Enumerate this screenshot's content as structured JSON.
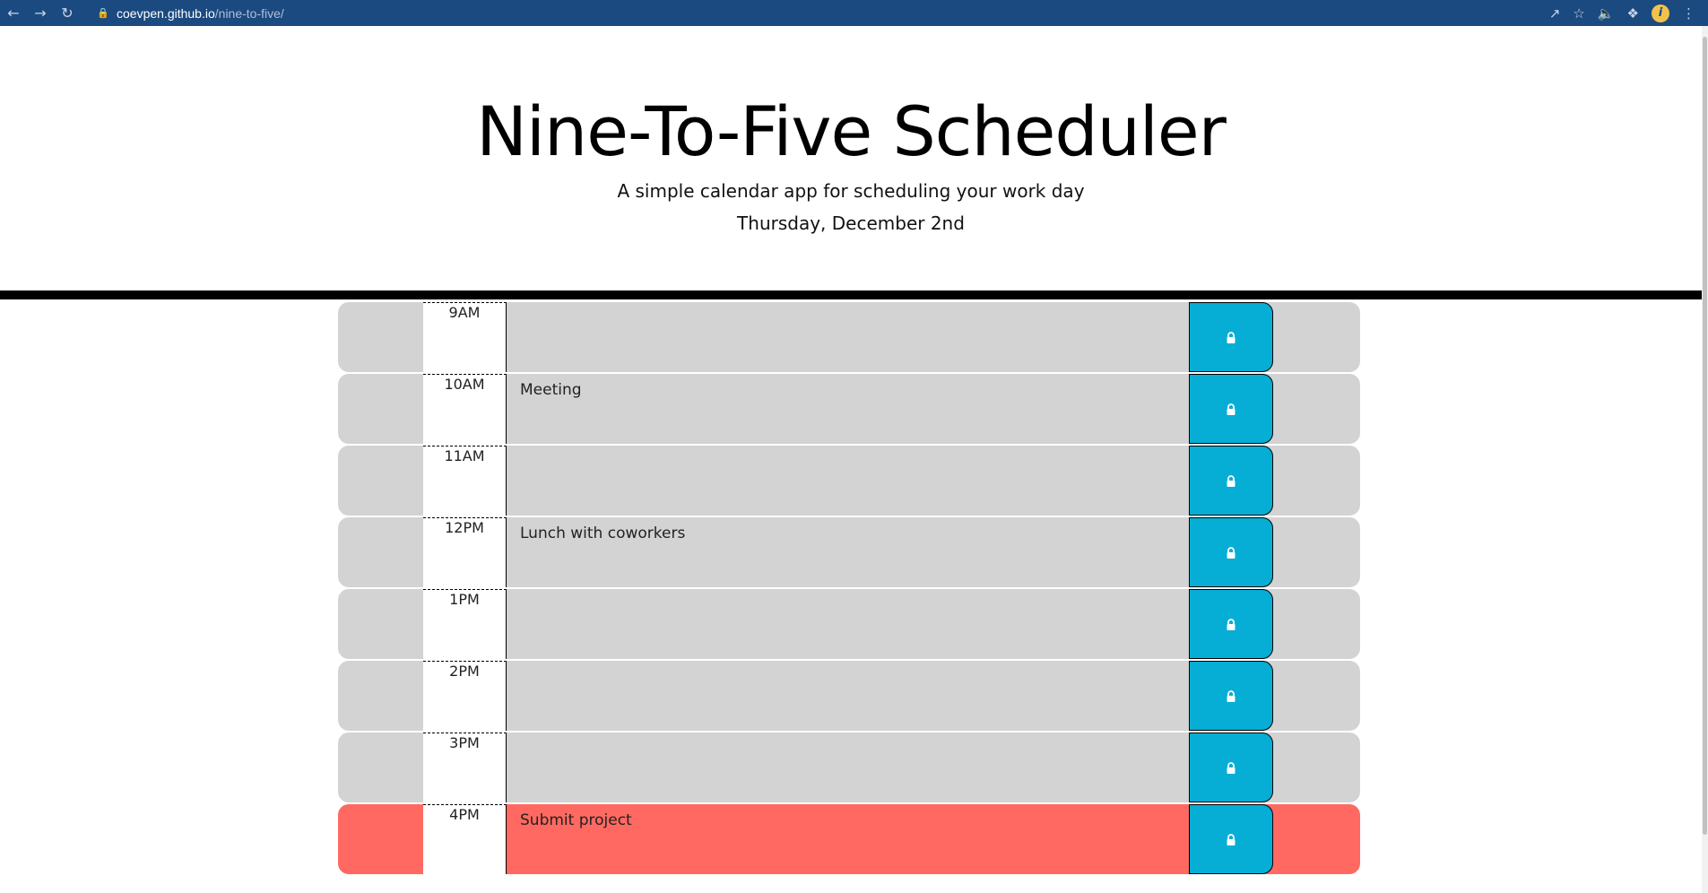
{
  "browser": {
    "url_host": "coevpen.github.io",
    "url_path": "/nine-to-five/"
  },
  "header": {
    "title": "Nine-To-Five Scheduler",
    "subtitle": "A simple calendar app for scheduling your work day",
    "current_date": "Thursday, December 2nd"
  },
  "schedule": {
    "rows": [
      {
        "hour": "9AM",
        "text": "",
        "state": "past"
      },
      {
        "hour": "10AM",
        "text": "Meeting",
        "state": "past"
      },
      {
        "hour": "11AM",
        "text": "",
        "state": "past"
      },
      {
        "hour": "12PM",
        "text": "Lunch with coworkers",
        "state": "past"
      },
      {
        "hour": "1PM",
        "text": "",
        "state": "past"
      },
      {
        "hour": "2PM",
        "text": "",
        "state": "past"
      },
      {
        "hour": "3PM",
        "text": "",
        "state": "past"
      },
      {
        "hour": "4PM",
        "text": "Submit project",
        "state": "present"
      }
    ]
  },
  "colors": {
    "past": "#d3d3d3",
    "present": "#ff6961",
    "save_button": "#06aed5"
  },
  "icons": {
    "save": "lock-icon"
  }
}
